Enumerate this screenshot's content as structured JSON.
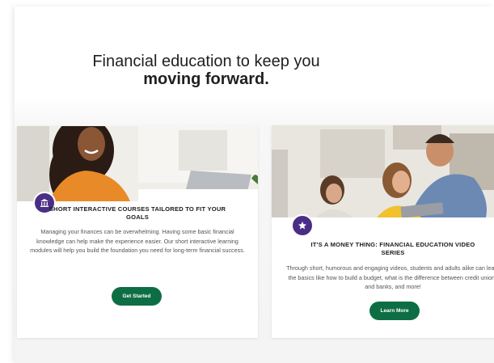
{
  "headline": {
    "line1": "Financial education to keep you",
    "line2": "moving forward."
  },
  "cards": [
    {
      "icon": "bank-icon",
      "title": "SHORT INTERACTIVE COURSES TAILORED TO FIT YOUR GOALS",
      "description": "Managing your finances can be overwhelming. Having some basic financial knowledge can help make the experience easier. Our short interactive learning modules will help you build the foundation you need for long-term financial success.",
      "button": "Get Started"
    },
    {
      "icon": "star-icon",
      "title": "IT'S A MONEY THING: FINANCIAL EDUCATION VIDEO SERIES",
      "description": "Through short, humorous and engaging videos, students and adults alike can learn the basics like how to build a budget, what is the difference between credit unions and banks, and more!",
      "button": "Learn More"
    }
  ],
  "colors": {
    "badge": "#4a2e86",
    "button": "#0e6e43",
    "headline": "#1f1f1f"
  }
}
